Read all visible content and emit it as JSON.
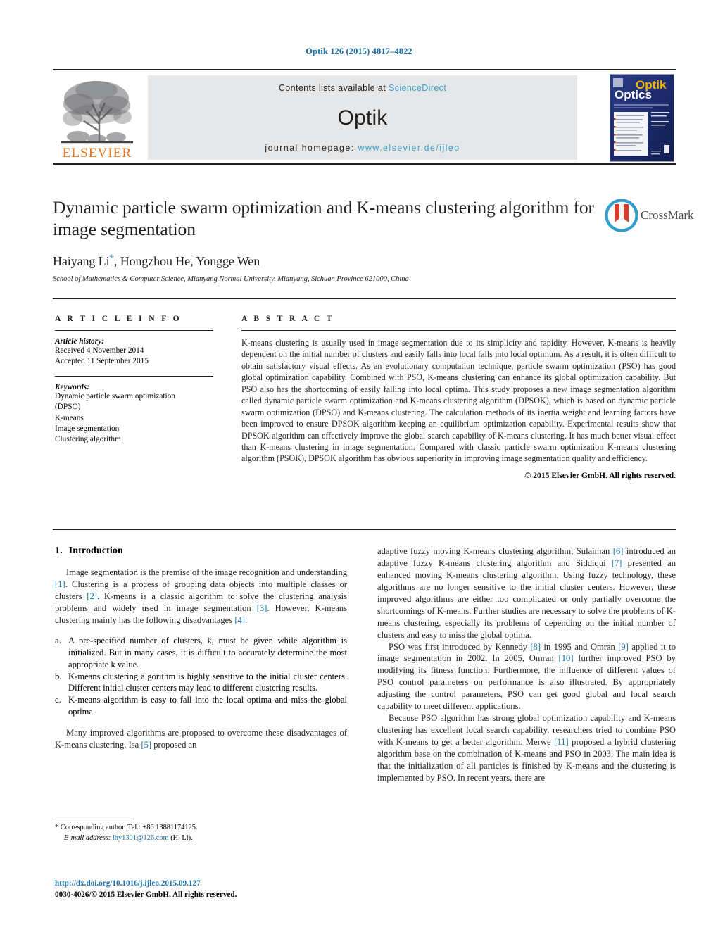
{
  "running_head": "Optik 126 (2015) 4817–4822",
  "masthead": {
    "publisher_logo_label": "ELSEVIER",
    "contents_prefix": "Contents lists available at",
    "contents_link": "ScienceDirect",
    "journal_title": "Optik",
    "homepage_prefix": "journal homepage:",
    "homepage_url": "www.elsevier.de/ijleo",
    "cover": {
      "title_primary": "Optik",
      "title_secondary": "Optics"
    }
  },
  "article": {
    "title": "Dynamic particle swarm optimization and K-means clustering algorithm for image segmentation",
    "authors": "Haiyang Li",
    "corresponding_marker": "*",
    "authors_rest": ", Hongzhou He, Yongge Wen",
    "affiliation": "School of Mathematics & Computer Science, Mianyang Normal University, Mianyang, Sichuan Province 621000, China",
    "crossmark_label": "CrossMark"
  },
  "article_info": {
    "heading": "A R T I C L E   I N F O",
    "history_heading": "Article history:",
    "history_lines": [
      "Received 4 November 2014",
      "Accepted 11 September 2015"
    ],
    "keywords_heading": "Keywords:",
    "keywords": [
      "Dynamic particle swarm optimization",
      "(DPSO)",
      "K-means",
      "Image segmentation",
      "Clustering algorithm"
    ]
  },
  "abstract": {
    "heading": "A B S T R A C T",
    "text": "K-means clustering is usually used in image segmentation due to its simplicity and rapidity. However, K-means is heavily dependent on the initial number of clusters and easily falls into local falls into local optimum. As a result, it is often difficult to obtain satisfactory visual effects. As an evolutionary computation technique, particle swarm optimization (PSO) has good global optimization capability. Combined with PSO, K-means clustering can enhance its global optimization capability. But PSO also has the shortcoming of easily falling into local optima. This study proposes a new image segmentation algorithm called dynamic particle swarm optimization and K-means clustering algorithm (DPSOK), which is based on dynamic particle swarm optimization (DPSO) and K-means clustering. The calculation methods of its inertia weight and learning factors have been improved to ensure DPSOK algorithm keeping an equilibrium optimization capability. Experimental results show that DPSOK algorithm can effectively improve the global search capability of K-means clustering. It has much better visual effect than K-means clustering in image segmentation. Compared with classic particle swarm optimization K-means clustering algorithm (PSOK), DPSOK algorithm has obvious superiority in improving image segmentation quality and efficiency.",
    "copyright": "© 2015 Elsevier GmbH. All rights reserved."
  },
  "introduction": {
    "section_number": "1.",
    "section_title": "Introduction",
    "para1_a": "Image segmentation is the premise of the image recognition and understanding ",
    "para1_r1": "[1]",
    "para1_b": ". Clustering is a process of grouping data objects into multiple classes or clusters ",
    "para1_r2": "[2]",
    "para1_c": ". K-means is a classic algorithm to solve the clustering analysis problems and widely used in image segmentation ",
    "para1_r3": "[3]",
    "para1_d": ". However, K-means clustering mainly has the following disadvantages ",
    "para1_r4": "[4]",
    "para1_e": ":",
    "list": [
      {
        "marker": "a.",
        "text": "A pre-specified number of clusters, k, must be given while algorithm is initialized. But in many cases, it is difficult to accurately determine the most appropriate k value."
      },
      {
        "marker": "b.",
        "text": "K-means clustering algorithm is highly sensitive to the initial cluster centers. Different initial cluster centers may lead to different clustering results."
      },
      {
        "marker": "c.",
        "text": "K-means algorithm is easy to fall into the local optima and miss the global optima."
      }
    ],
    "para2_a": "Many improved algorithms are proposed to overcome these disadvantages of K-means clustering. Isa ",
    "para2_r5": "[5]",
    "para2_b": " proposed an"
  },
  "right_column": {
    "para3_a": "adaptive fuzzy moving K-means clustering algorithm, Sulaiman ",
    "para3_r6": "[6]",
    "para3_b": " introduced an adaptive fuzzy K-means clustering algorithm and Siddiqui ",
    "para3_r7": "[7]",
    "para3_c": " presented an enhanced moving K-means clustering algorithm. Using fuzzy technology, these algorithms are no longer sensitive to the initial cluster centers. However, these improved algorithms are either too complicated or only partially overcome the shortcomings of K-means. Further studies are necessary to solve the problems of K-means clustering, especially its problems of depending on the initial number of clusters and easy to miss the global optima.",
    "para4_a": "PSO was first introduced by Kennedy ",
    "para4_r8": "[8]",
    "para4_b": " in 1995 and Omran ",
    "para4_r9": "[9]",
    "para4_c": " applied it to image segmentation in 2002. In 2005, Omran ",
    "para4_r10": "[10]",
    "para4_d": " further improved PSO by modifying its fitness function. Furthermore, the influence of different values of PSO control parameters on performance is also illustrated. By appropriately adjusting the control parameters, PSO can get good global and local search capability to meet different applications.",
    "para5_a": "Because PSO algorithm has strong global optimization capability and K-means clustering has excellent local search capability, researchers tried to combine PSO with K-means to get a better algorithm. Merwe ",
    "para5_r11": "[11]",
    "para5_b": " proposed a hybrid clustering algorithm base on the combination of K-means and PSO in 2003. The main idea is that the initialization of all particles is finished by K-means and the clustering is implemented by PSO. In recent years, there are"
  },
  "footnote": {
    "corresponding": "* Corresponding author. Tel.: +86 13881174125.",
    "email_label": "E-mail address:",
    "email": "lhy1301@126.com",
    "email_suffix": "(H. Li)."
  },
  "footer": {
    "doi": "http://dx.doi.org/10.1016/j.ijleo.2015.09.127",
    "issn_line": "0030-4026/© 2015 Elsevier GmbH. All rights reserved."
  },
  "colors": {
    "link_blue": "#1a72a8",
    "sciencedirect_blue": "#3ba3d0",
    "elsevier_orange": "#e87722",
    "band_gray": "#e6e7e8",
    "cover_navy": "#1b2a6b"
  }
}
